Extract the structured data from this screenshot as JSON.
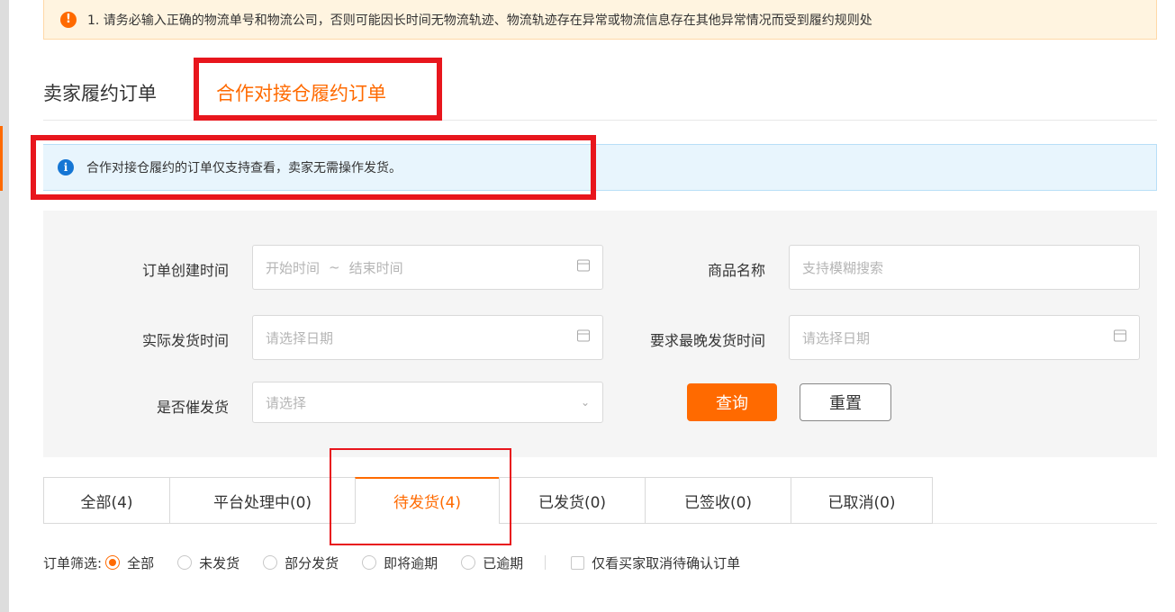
{
  "warning": {
    "icon": "exclamation-icon",
    "text": "1. 请务必输入正确的物流单号和物流公司，否则可能因长时间无物流轨迹、物流轨迹存在异常或物流信息存在其他异常情况而受到履约规则处"
  },
  "page_tabs": [
    {
      "label": "卖家履约订单"
    },
    {
      "label": "合作对接仓履约订单"
    }
  ],
  "info": {
    "icon": "info-icon",
    "text": "合作对接仓履约的订单仅支持查看，卖家无需操作发货。"
  },
  "filters": {
    "order_create_time": {
      "label": "订单创建时间",
      "start_placeholder": "开始时间",
      "separator": "~",
      "end_placeholder": "结束时间",
      "icon": "calendar-icon"
    },
    "product_name": {
      "label": "商品名称",
      "placeholder": "支持模糊搜索"
    },
    "actual_ship_time": {
      "label": "实际发货时间",
      "placeholder": "请选择日期",
      "icon": "calendar-icon"
    },
    "latest_ship_time": {
      "label": "要求最晚发货时间",
      "placeholder": "请选择日期",
      "icon": "calendar-icon"
    },
    "urged": {
      "label": "是否催发货",
      "placeholder": "请选择",
      "icon": "chevron-down-icon"
    },
    "query_label": "查询",
    "reset_label": "重置"
  },
  "status_tabs": [
    {
      "label": "全部(4)"
    },
    {
      "label": "平台处理中(0)"
    },
    {
      "label": "待发货(4)",
      "active": true
    },
    {
      "label": "已发货(0)"
    },
    {
      "label": "已签收(0)"
    },
    {
      "label": "已取消(0)"
    }
  ],
  "order_filter": {
    "label": "订单筛选:",
    "options": [
      "全部",
      "未发货",
      "部分发货",
      "即将逾期",
      "已逾期"
    ],
    "selected": "全部",
    "checkbox_label": "仅看买家取消待确认订单"
  },
  "colors": {
    "accent": "#ff6a00",
    "highlight_red": "#e8161d",
    "info_blue": "#1576d4"
  }
}
